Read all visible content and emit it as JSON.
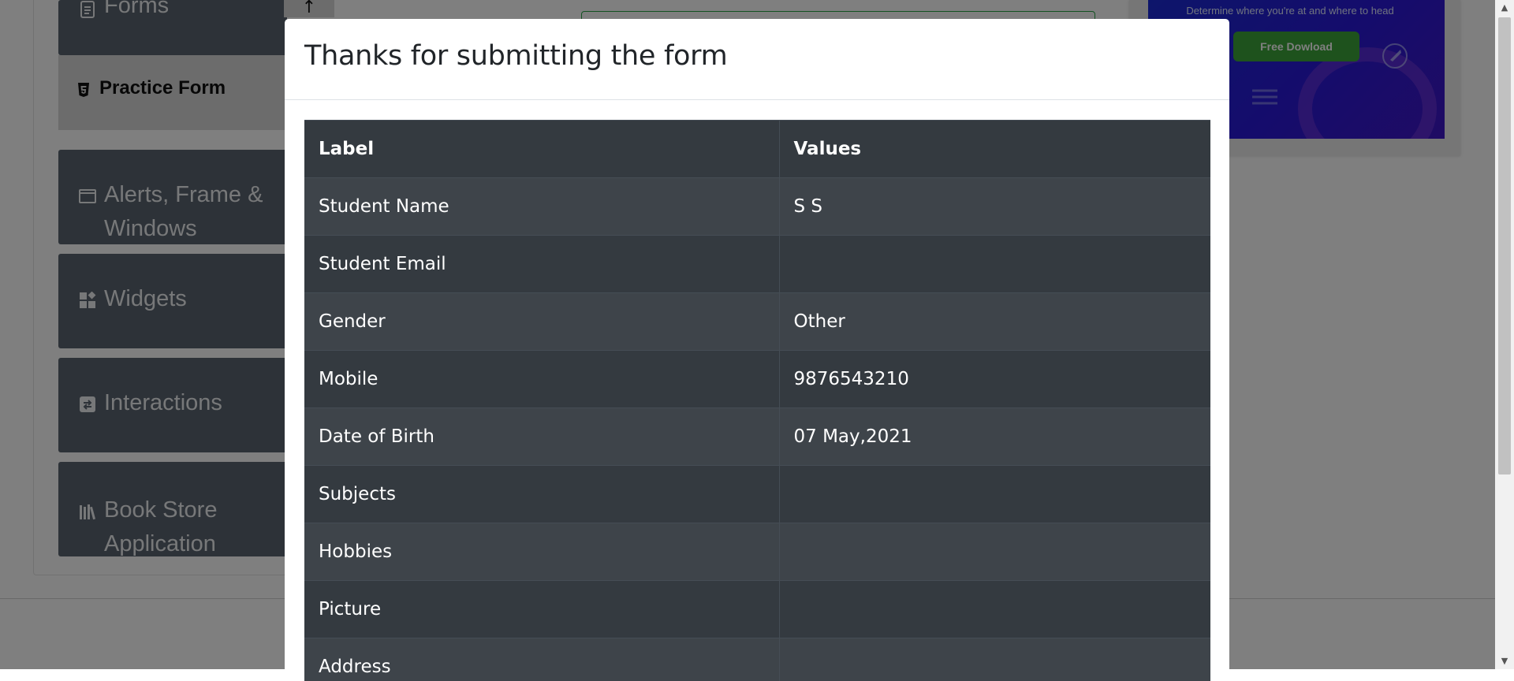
{
  "sidebar": {
    "groups": [
      {
        "label": "Forms",
        "icon": "document-icon"
      },
      {
        "label": "Alerts, Frame & Windows",
        "icon": "window-icon"
      },
      {
        "label": "Widgets",
        "icon": "widgets-icon"
      },
      {
        "label": "Interactions",
        "icon": "interactions-icon"
      },
      {
        "label": "Book Store Application",
        "icon": "books-icon"
      }
    ],
    "active_item": {
      "label": "Practice Form",
      "icon": "html5-icon"
    }
  },
  "ad": {
    "tagline": "Determine where you're at and where to head",
    "button_label": "Free Dowload"
  },
  "modal": {
    "title": "Thanks for submitting the form",
    "table": {
      "headers": [
        "Label",
        "Values"
      ],
      "rows": [
        [
          "Student Name",
          "S S"
        ],
        [
          "Student Email",
          ""
        ],
        [
          "Gender",
          "Other"
        ],
        [
          "Mobile",
          "9876543210"
        ],
        [
          "Date of Birth",
          "07 May,2021"
        ],
        [
          "Subjects",
          ""
        ],
        [
          "Hobbies",
          ""
        ],
        [
          "Picture",
          ""
        ],
        [
          "Address",
          ""
        ]
      ]
    }
  },
  "colors": {
    "table_dark": "#343a40",
    "table_striped": "#3e444a",
    "backdrop": "rgba(0,0,0,0.5)",
    "ad_button": "#3da53a"
  }
}
